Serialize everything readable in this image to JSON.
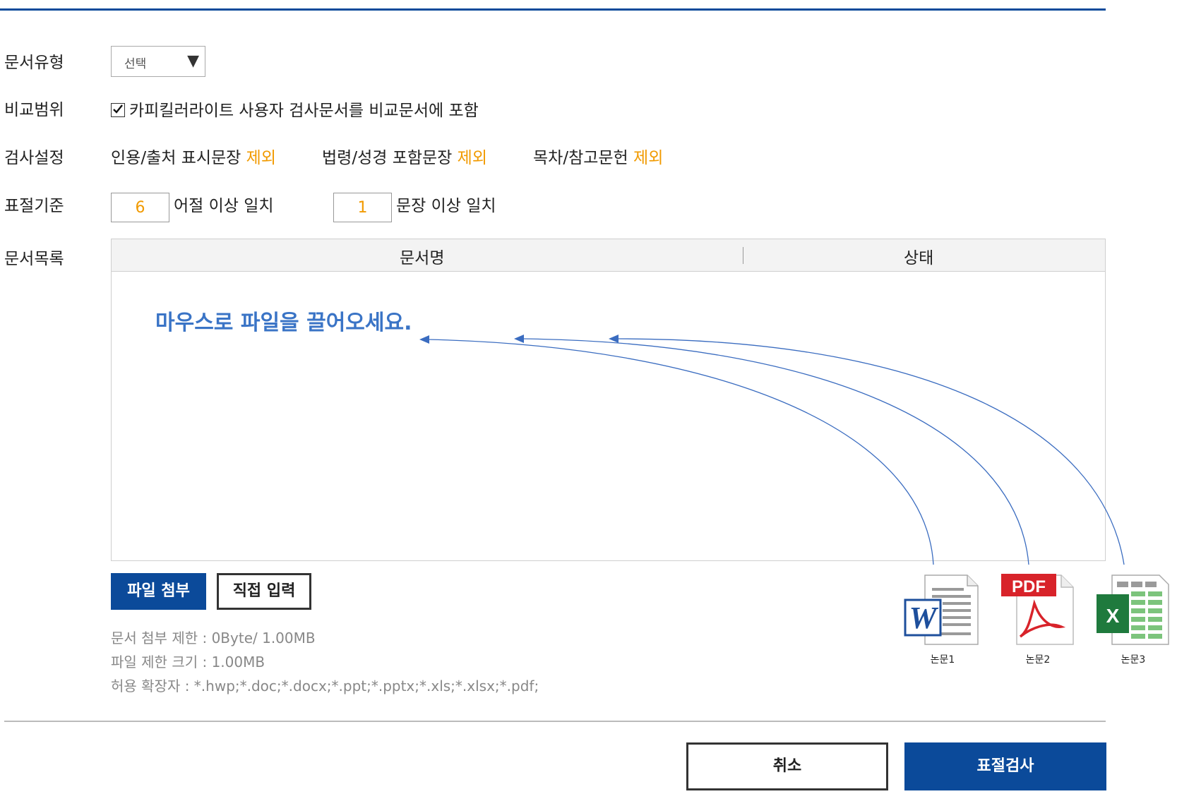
{
  "form": {
    "doc_type": {
      "label": "문서유형",
      "selected": "선택"
    },
    "compare_scope": {
      "label": "비교범위",
      "checkbox_text": "카피킬러라이트 사용자 검사문서를 비교문서에 포함",
      "checked": true
    },
    "check_settings": {
      "label": "검사설정",
      "items": [
        {
          "text": "인용/출처 표시문장",
          "action": "제외"
        },
        {
          "text": "법령/성경 포함문장",
          "action": "제외"
        },
        {
          "text": "목차/참고문헌",
          "action": "제외"
        }
      ]
    },
    "criteria": {
      "label": "표절기준",
      "word_value": "6",
      "word_suffix": "어절 이상 일치",
      "sentence_value": "1",
      "sentence_suffix": "문장 이상 일치"
    },
    "doc_list": {
      "label": "문서목록",
      "columns": [
        "문서명",
        "상태"
      ],
      "drop_hint": "마우스로 파일을 끌어오세요."
    }
  },
  "buttons": {
    "attach": "파일 첨부",
    "direct_input": "직접 입력",
    "cancel": "취소",
    "check": "표절검사"
  },
  "info": {
    "limit": "문서 첨부 제한 : 0Byte/ 1.00MB",
    "size": "파일 제한 크기 : 1.00MB",
    "ext": "허용 확장자 : *.hwp;*.doc;*.docx;*.ppt;*.pptx;*.xls;*.xlsx;*.pdf;"
  },
  "files": [
    {
      "name": "논문1",
      "icon": "word-file-icon",
      "badge": "W"
    },
    {
      "name": "논문2",
      "icon": "pdf-file-icon",
      "badge": "PDF"
    },
    {
      "name": "논문3",
      "icon": "excel-file-icon",
      "badge": "X"
    }
  ],
  "colors": {
    "primary": "#0b4a9a",
    "accent": "#f19a00",
    "hint": "#3a74c6"
  }
}
